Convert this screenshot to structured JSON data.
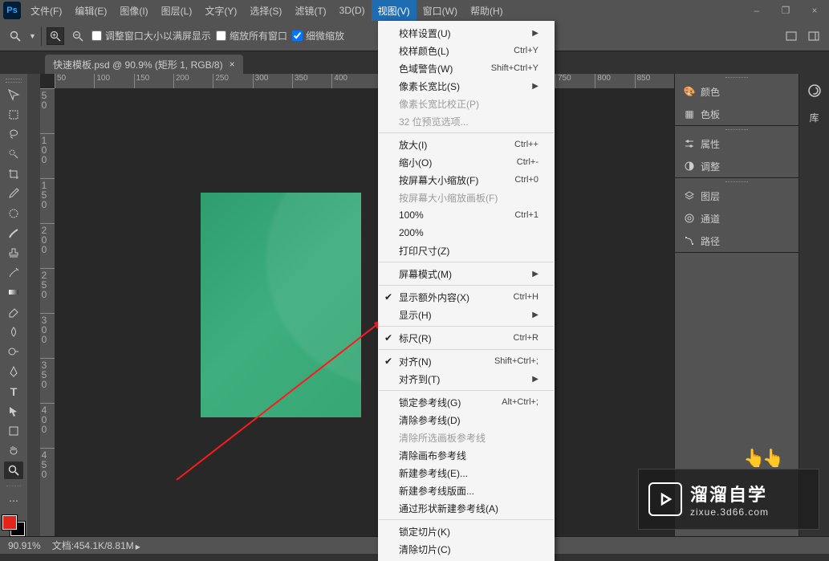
{
  "app_logo": "Ps",
  "menus": [
    "文件(F)",
    "编辑(E)",
    "图像(I)",
    "图层(L)",
    "文字(Y)",
    "选择(S)",
    "滤镜(T)",
    "3D(D)",
    "视图(V)",
    "窗口(W)",
    "帮助(H)"
  ],
  "active_menu_index": 8,
  "window_controls": {
    "min": "–",
    "max": "❐",
    "close": "×"
  },
  "optbar": {
    "chk1": "调整窗口大小以满屏显示",
    "chk2": "缩放所有窗口",
    "chk3": "细微缩放",
    "chk3_checked": true
  },
  "doctab": {
    "title": "快速模板.psd @ 90.9% (矩形 1, RGB/8)",
    "close": "×"
  },
  "ruler_h": [
    "50",
    "100",
    "150",
    "200",
    "250",
    "300",
    "350",
    "400",
    "700",
    "750",
    "800",
    "850"
  ],
  "ruler_v": [
    "50",
    "100",
    "150",
    "200",
    "250",
    "300",
    "350",
    "400",
    "450"
  ],
  "panels": {
    "color": "颜色",
    "swatches": "色板",
    "props": "属性",
    "adjust": "调整",
    "layers": "图层",
    "channels": "通道",
    "paths": "路径",
    "lib": "库"
  },
  "status": {
    "zoom": "90.91%",
    "doc_label": "文档:",
    "doc": "454.1K/8.81M"
  },
  "dropdown": [
    {
      "t": "校样设置(U)",
      "sub": true
    },
    {
      "t": "校样颜色(L)",
      "sc": "Ctrl+Y"
    },
    {
      "t": "色域警告(W)",
      "sc": "Shift+Ctrl+Y"
    },
    {
      "t": "像素长宽比(S)",
      "sub": true
    },
    {
      "t": "像素长宽比校正(P)",
      "dis": true
    },
    {
      "t": "32 位预览选项...",
      "dis": true
    },
    {
      "hr": true
    },
    {
      "t": "放大(I)",
      "sc": "Ctrl++"
    },
    {
      "t": "缩小(O)",
      "sc": "Ctrl+-"
    },
    {
      "t": "按屏幕大小缩放(F)",
      "sc": "Ctrl+0"
    },
    {
      "t": "按屏幕大小缩放画板(F)",
      "dis": true
    },
    {
      "t": "100%",
      "sc": "Ctrl+1"
    },
    {
      "t": "200%"
    },
    {
      "t": "打印尺寸(Z)"
    },
    {
      "hr": true
    },
    {
      "t": "屏幕模式(M)",
      "sub": true
    },
    {
      "hr": true
    },
    {
      "t": "显示额外内容(X)",
      "sc": "Ctrl+H",
      "chk": true
    },
    {
      "t": "显示(H)",
      "sub": true
    },
    {
      "hr": true
    },
    {
      "t": "标尺(R)",
      "sc": "Ctrl+R",
      "chk": true
    },
    {
      "hr": true
    },
    {
      "t": "对齐(N)",
      "sc": "Shift+Ctrl+;",
      "chk": true
    },
    {
      "t": "对齐到(T)",
      "sub": true
    },
    {
      "hr": true
    },
    {
      "t": "锁定参考线(G)",
      "sc": "Alt+Ctrl+;"
    },
    {
      "t": "清除参考线(D)"
    },
    {
      "t": "清除所选画板参考线",
      "dis": true
    },
    {
      "t": "清除画布参考线"
    },
    {
      "t": "新建参考线(E)..."
    },
    {
      "t": "新建参考线版面..."
    },
    {
      "t": "通过形状新建参考线(A)"
    },
    {
      "hr": true
    },
    {
      "t": "锁定切片(K)"
    },
    {
      "t": "清除切片(C)"
    }
  ],
  "brand": {
    "name": "溜溜自学",
    "url": "zixue.3d66.com"
  }
}
